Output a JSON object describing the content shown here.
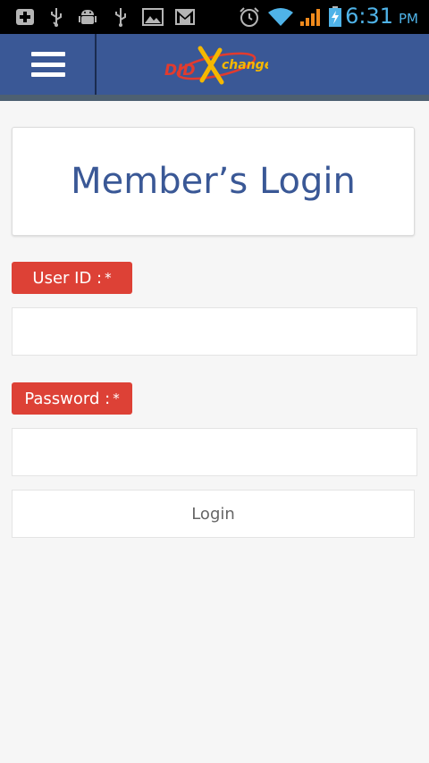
{
  "status_bar": {
    "time": "6:31",
    "ampm": "PM",
    "icons": [
      "add-notification-icon",
      "usb-icon",
      "android-debug-icon",
      "usb-icon",
      "image-icon",
      "gmail-icon",
      "alarm-icon",
      "wifi-icon",
      "signal-icon",
      "battery-charging-icon"
    ],
    "colors": {
      "background": "#000000",
      "accent": "#4fb3e8",
      "signal": "#f08a1c"
    }
  },
  "app_bar": {
    "menu_icon": "hamburger-menu-icon",
    "logo_text_a": "DID",
    "logo_text_b": "change",
    "colors": {
      "background": "#3a5896"
    }
  },
  "main": {
    "title": "Member’s Login",
    "user_id_label": "User ID :",
    "password_label": "Password :",
    "required_mark": "*",
    "user_id_value": "",
    "password_value": "",
    "login_label": "Login",
    "colors": {
      "label_bg": "#dd4136",
      "title": "#3a5896"
    }
  }
}
